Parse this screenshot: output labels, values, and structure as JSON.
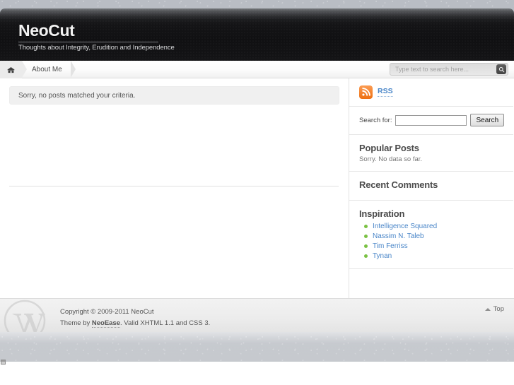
{
  "site": {
    "title": "NeoCut",
    "description": "Thoughts about Integrity, Erudition and Independence"
  },
  "nav": {
    "home_icon": "home-icon",
    "items": [
      {
        "label": "About Me"
      }
    ],
    "search": {
      "placeholder": "Type text to search here...",
      "value": "",
      "button_icon": "search-icon"
    }
  },
  "content": {
    "notice": "Sorry, no posts matched your criteria."
  },
  "sidebar": {
    "rss": {
      "icon": "rss-icon",
      "label": "RSS"
    },
    "search": {
      "label": "Search for:",
      "value": "",
      "button_label": "Search"
    },
    "popular_posts": {
      "title": "Popular Posts",
      "note": "Sorry. No data so far."
    },
    "recent_comments": {
      "title": "Recent Comments"
    },
    "inspiration": {
      "title": "Inspiration",
      "links": [
        {
          "label": "Intelligence Squared"
        },
        {
          "label": "Nassim N. Taleb"
        },
        {
          "label": "Tim Ferriss"
        },
        {
          "label": "Tynan"
        }
      ]
    }
  },
  "footer": {
    "logo_icon": "wordpress-logo-icon",
    "copyright": "Copyright © 2009-2011 NeoCut",
    "theme_prefix": "Theme by ",
    "theme_author": "NeoEase",
    "theme_suffix": ". Valid XHTML 1.1 and CSS 3.",
    "top_label": "Top",
    "top_icon": "caret-up-icon"
  },
  "colors": {
    "header_dark": "#101012",
    "link_blue": "#4a86c8",
    "rss_orange": "#ee7012",
    "bullet_green": "#7ac143",
    "page_backdrop": "#b9bdc4"
  }
}
